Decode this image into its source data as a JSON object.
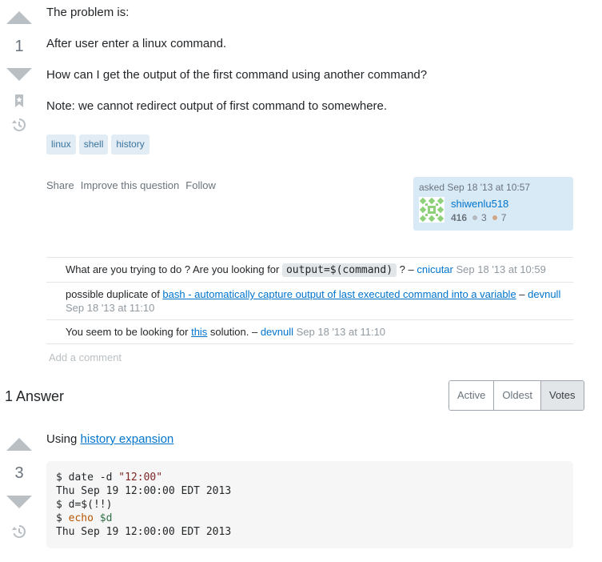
{
  "question": {
    "votes": "1",
    "paragraphs": [
      "The problem is:",
      "After user enter a linux command.",
      "How can I get the output of the first command using another command?",
      "Note: we cannot redirect output of first command to somewhere."
    ],
    "tags": [
      "linux",
      "shell",
      "history"
    ],
    "menu": {
      "share": "Share",
      "improve": "Improve this question",
      "follow": "Follow"
    },
    "owner": {
      "asked": "asked Sep 18 '13 at 10:57",
      "name": "shiwenlu518",
      "reputation": "416",
      "silver": "3",
      "bronze": "7"
    }
  },
  "comments": [
    {
      "pre": "What are you trying to do ? Are you looking for ",
      "code": "output=$(command)",
      "post": " ? – ",
      "user": "cnicutar",
      "date": "Sep 18 '13 at 10:59"
    },
    {
      "pre": "possible duplicate of ",
      "link": "bash - automatically capture output of last executed command into a variable",
      "post": " – ",
      "user": "devnull",
      "date": "Sep 18 '13 at 11:10"
    },
    {
      "pre": "You seem to be looking for ",
      "link": "this",
      "post": " solution. – ",
      "user": "devnull",
      "date": "Sep 18 '13 at 11:10"
    }
  ],
  "add_comment": "Add a comment",
  "answers_header": {
    "count": "1",
    "label": "Answer"
  },
  "sort_tabs": [
    "Active",
    "Oldest",
    "Votes"
  ],
  "answer": {
    "votes": "3",
    "intro": "Using ",
    "link": "history expansion",
    "code": {
      "l1_prompt": "$ date -d ",
      "l1_str": "\"12:00\"",
      "l2": "Thu Sep 19 12:00:00 EDT 2013",
      "l3": "$ d=$(!!)",
      "l4_prompt": "$ ",
      "l4_kw": "echo",
      "l4_var": "$d",
      "l5": "Thu Sep 19 12:00:00 EDT 2013"
    }
  },
  "colors": {
    "link": "#0074cc",
    "tag_bg": "#e1ecf4",
    "owner_bg": "#d9eaf7",
    "silver": "#b4b8bc",
    "bronze": "#d1a684"
  }
}
